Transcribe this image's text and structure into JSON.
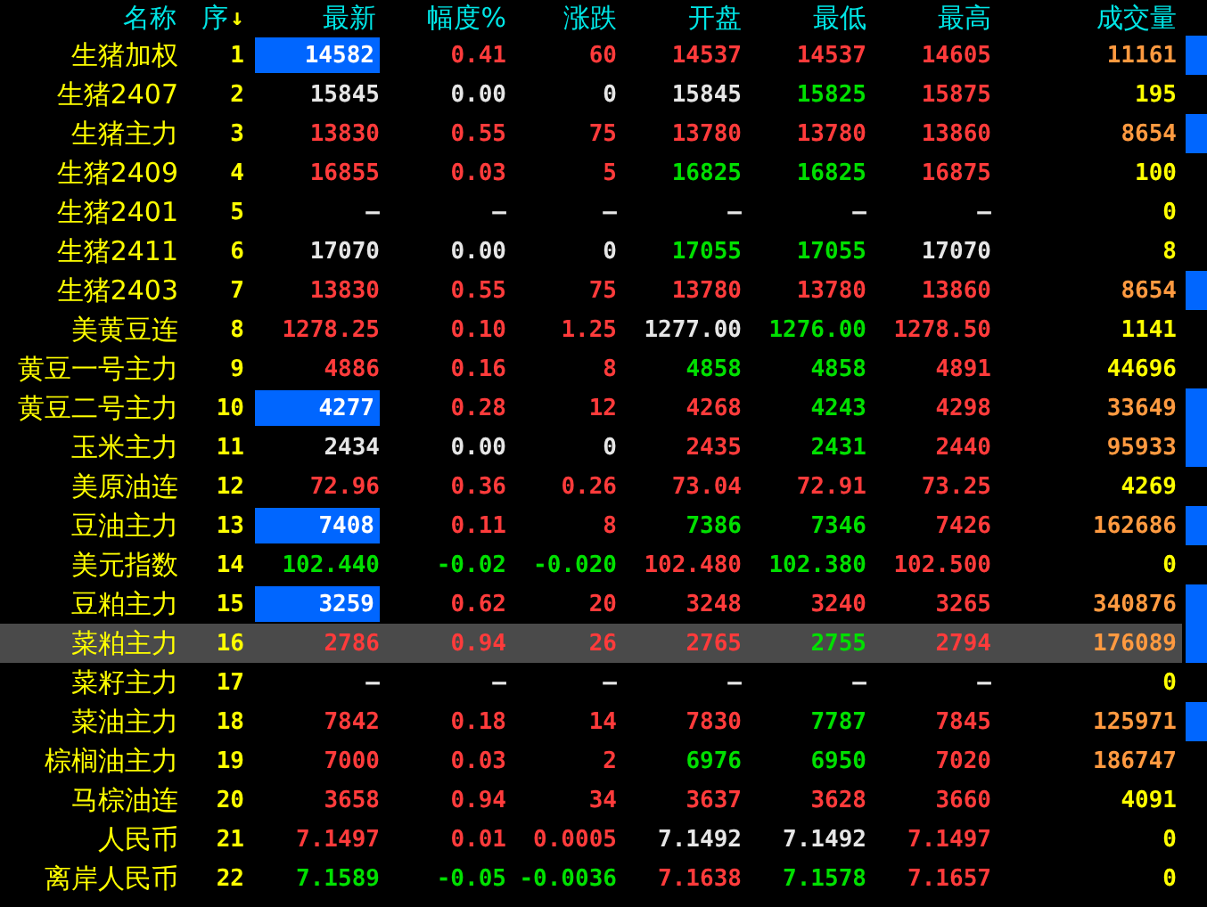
{
  "columns": [
    {
      "label": "名称"
    },
    {
      "label": "序",
      "sort_mark": "↓"
    },
    {
      "label": "最新"
    },
    {
      "label": "幅度%"
    },
    {
      "label": "涨跌"
    },
    {
      "label": "开盘"
    },
    {
      "label": "最低"
    },
    {
      "label": "最高"
    },
    {
      "label": "成交量"
    }
  ],
  "rows": [
    {
      "name": "生猪加权",
      "no": "1",
      "flash": true,
      "marker": true,
      "selected": false,
      "cells": [
        {
          "text": "14582",
          "color": "#ffffff"
        },
        {
          "text": "0.41",
          "color": "#ff3b3b"
        },
        {
          "text": "60",
          "color": "#ff3b3b"
        },
        {
          "text": "14537",
          "color": "#ff3b3b"
        },
        {
          "text": "14537",
          "color": "#ff3b3b"
        },
        {
          "text": "14605",
          "color": "#ff3b3b"
        },
        {
          "text": "11161",
          "color": "#ff9a40"
        }
      ]
    },
    {
      "name": "生猪2407",
      "no": "2",
      "flash": false,
      "marker": false,
      "selected": false,
      "cells": [
        {
          "text": "15845",
          "color": "#e6e6e6"
        },
        {
          "text": "0.00",
          "color": "#e6e6e6"
        },
        {
          "text": "0",
          "color": "#e6e6e6"
        },
        {
          "text": "15845",
          "color": "#e6e6e6"
        },
        {
          "text": "15825",
          "color": "#00e000"
        },
        {
          "text": "15875",
          "color": "#ff3b3b"
        },
        {
          "text": "195",
          "color": "#ffff00"
        }
      ]
    },
    {
      "name": "生猪主力",
      "no": "3",
      "flash": false,
      "marker": true,
      "selected": false,
      "cells": [
        {
          "text": "13830",
          "color": "#ff3b3b"
        },
        {
          "text": "0.55",
          "color": "#ff3b3b"
        },
        {
          "text": "75",
          "color": "#ff3b3b"
        },
        {
          "text": "13780",
          "color": "#ff3b3b"
        },
        {
          "text": "13780",
          "color": "#ff3b3b"
        },
        {
          "text": "13860",
          "color": "#ff3b3b"
        },
        {
          "text": "8654",
          "color": "#ff9a40"
        }
      ]
    },
    {
      "name": "生猪2409",
      "no": "4",
      "flash": false,
      "marker": false,
      "selected": false,
      "cells": [
        {
          "text": "16855",
          "color": "#ff3b3b"
        },
        {
          "text": "0.03",
          "color": "#ff3b3b"
        },
        {
          "text": "5",
          "color": "#ff3b3b"
        },
        {
          "text": "16825",
          "color": "#00e000"
        },
        {
          "text": "16825",
          "color": "#00e000"
        },
        {
          "text": "16875",
          "color": "#ff3b3b"
        },
        {
          "text": "100",
          "color": "#ffff00"
        }
      ]
    },
    {
      "name": "生猪2401",
      "no": "5",
      "flash": false,
      "marker": false,
      "selected": false,
      "cells": [
        {
          "text": "—",
          "color": "#e6e6e6"
        },
        {
          "text": "—",
          "color": "#e6e6e6"
        },
        {
          "text": "—",
          "color": "#e6e6e6"
        },
        {
          "text": "—",
          "color": "#e6e6e6"
        },
        {
          "text": "—",
          "color": "#e6e6e6"
        },
        {
          "text": "—",
          "color": "#e6e6e6"
        },
        {
          "text": "0",
          "color": "#ffff00"
        }
      ]
    },
    {
      "name": "生猪2411",
      "no": "6",
      "flash": false,
      "marker": false,
      "selected": false,
      "cells": [
        {
          "text": "17070",
          "color": "#e6e6e6"
        },
        {
          "text": "0.00",
          "color": "#e6e6e6"
        },
        {
          "text": "0",
          "color": "#e6e6e6"
        },
        {
          "text": "17055",
          "color": "#00e000"
        },
        {
          "text": "17055",
          "color": "#00e000"
        },
        {
          "text": "17070",
          "color": "#e6e6e6"
        },
        {
          "text": "8",
          "color": "#ffff00"
        }
      ]
    },
    {
      "name": "生猪2403",
      "no": "7",
      "flash": false,
      "marker": true,
      "selected": false,
      "cells": [
        {
          "text": "13830",
          "color": "#ff3b3b"
        },
        {
          "text": "0.55",
          "color": "#ff3b3b"
        },
        {
          "text": "75",
          "color": "#ff3b3b"
        },
        {
          "text": "13780",
          "color": "#ff3b3b"
        },
        {
          "text": "13780",
          "color": "#ff3b3b"
        },
        {
          "text": "13860",
          "color": "#ff3b3b"
        },
        {
          "text": "8654",
          "color": "#ff9a40"
        }
      ]
    },
    {
      "name": "美黄豆连",
      "no": "8",
      "flash": false,
      "marker": false,
      "selected": false,
      "cells": [
        {
          "text": "1278.25",
          "color": "#ff3b3b"
        },
        {
          "text": "0.10",
          "color": "#ff3b3b"
        },
        {
          "text": "1.25",
          "color": "#ff3b3b"
        },
        {
          "text": "1277.00",
          "color": "#e6e6e6"
        },
        {
          "text": "1276.00",
          "color": "#00e000"
        },
        {
          "text": "1278.50",
          "color": "#ff3b3b"
        },
        {
          "text": "1141",
          "color": "#ffff00"
        }
      ]
    },
    {
      "name": "黄豆一号主力",
      "no": "9",
      "flash": false,
      "marker": false,
      "selected": false,
      "cells": [
        {
          "text": "4886",
          "color": "#ff3b3b"
        },
        {
          "text": "0.16",
          "color": "#ff3b3b"
        },
        {
          "text": "8",
          "color": "#ff3b3b"
        },
        {
          "text": "4858",
          "color": "#00e000"
        },
        {
          "text": "4858",
          "color": "#00e000"
        },
        {
          "text": "4891",
          "color": "#ff3b3b"
        },
        {
          "text": "44696",
          "color": "#ffff00"
        }
      ]
    },
    {
      "name": "黄豆二号主力",
      "no": "10",
      "flash": true,
      "marker": true,
      "selected": false,
      "cells": [
        {
          "text": "4277",
          "color": "#ffffff"
        },
        {
          "text": "0.28",
          "color": "#ff3b3b"
        },
        {
          "text": "12",
          "color": "#ff3b3b"
        },
        {
          "text": "4268",
          "color": "#ff3b3b"
        },
        {
          "text": "4243",
          "color": "#00e000"
        },
        {
          "text": "4298",
          "color": "#ff3b3b"
        },
        {
          "text": "33649",
          "color": "#ff9a40"
        }
      ]
    },
    {
      "name": "玉米主力",
      "no": "11",
      "flash": false,
      "marker": true,
      "selected": false,
      "cells": [
        {
          "text": "2434",
          "color": "#e6e6e6"
        },
        {
          "text": "0.00",
          "color": "#e6e6e6"
        },
        {
          "text": "0",
          "color": "#e6e6e6"
        },
        {
          "text": "2435",
          "color": "#ff3b3b"
        },
        {
          "text": "2431",
          "color": "#00e000"
        },
        {
          "text": "2440",
          "color": "#ff3b3b"
        },
        {
          "text": "95933",
          "color": "#ff9a40"
        }
      ]
    },
    {
      "name": "美原油连",
      "no": "12",
      "flash": false,
      "marker": false,
      "selected": false,
      "cells": [
        {
          "text": "72.96",
          "color": "#ff3b3b"
        },
        {
          "text": "0.36",
          "color": "#ff3b3b"
        },
        {
          "text": "0.26",
          "color": "#ff3b3b"
        },
        {
          "text": "73.04",
          "color": "#ff3b3b"
        },
        {
          "text": "72.91",
          "color": "#ff3b3b"
        },
        {
          "text": "73.25",
          "color": "#ff3b3b"
        },
        {
          "text": "4269",
          "color": "#ffff00"
        }
      ]
    },
    {
      "name": "豆油主力",
      "no": "13",
      "flash": true,
      "marker": true,
      "selected": false,
      "cells": [
        {
          "text": "7408",
          "color": "#ffffff"
        },
        {
          "text": "0.11",
          "color": "#ff3b3b"
        },
        {
          "text": "8",
          "color": "#ff3b3b"
        },
        {
          "text": "7386",
          "color": "#00e000"
        },
        {
          "text": "7346",
          "color": "#00e000"
        },
        {
          "text": "7426",
          "color": "#ff3b3b"
        },
        {
          "text": "162686",
          "color": "#ff9a40"
        }
      ]
    },
    {
      "name": "美元指数",
      "no": "14",
      "flash": false,
      "marker": false,
      "selected": false,
      "cells": [
        {
          "text": "102.440",
          "color": "#00e000"
        },
        {
          "text": "-0.02",
          "color": "#00e000"
        },
        {
          "text": "-0.020",
          "color": "#00e000"
        },
        {
          "text": "102.480",
          "color": "#ff3b3b"
        },
        {
          "text": "102.380",
          "color": "#00e000"
        },
        {
          "text": "102.500",
          "color": "#ff3b3b"
        },
        {
          "text": "0",
          "color": "#ffff00"
        }
      ]
    },
    {
      "name": "豆粕主力",
      "no": "15",
      "flash": true,
      "marker": true,
      "selected": false,
      "cells": [
        {
          "text": "3259",
          "color": "#ffffff"
        },
        {
          "text": "0.62",
          "color": "#ff3b3b"
        },
        {
          "text": "20",
          "color": "#ff3b3b"
        },
        {
          "text": "3248",
          "color": "#ff3b3b"
        },
        {
          "text": "3240",
          "color": "#ff3b3b"
        },
        {
          "text": "3265",
          "color": "#ff3b3b"
        },
        {
          "text": "340876",
          "color": "#ff9a40"
        }
      ]
    },
    {
      "name": "菜粕主力",
      "no": "16",
      "flash": false,
      "marker": true,
      "selected": true,
      "cells": [
        {
          "text": "2786",
          "color": "#ff3b3b"
        },
        {
          "text": "0.94",
          "color": "#ff3b3b"
        },
        {
          "text": "26",
          "color": "#ff3b3b"
        },
        {
          "text": "2765",
          "color": "#ff3b3b"
        },
        {
          "text": "2755",
          "color": "#00e000"
        },
        {
          "text": "2794",
          "color": "#ff3b3b"
        },
        {
          "text": "176089",
          "color": "#ff9a40"
        }
      ]
    },
    {
      "name": "菜籽主力",
      "no": "17",
      "flash": false,
      "marker": false,
      "selected": false,
      "cells": [
        {
          "text": "—",
          "color": "#e6e6e6"
        },
        {
          "text": "—",
          "color": "#e6e6e6"
        },
        {
          "text": "—",
          "color": "#e6e6e6"
        },
        {
          "text": "—",
          "color": "#e6e6e6"
        },
        {
          "text": "—",
          "color": "#e6e6e6"
        },
        {
          "text": "—",
          "color": "#e6e6e6"
        },
        {
          "text": "0",
          "color": "#ffff00"
        }
      ]
    },
    {
      "name": "菜油主力",
      "no": "18",
      "flash": false,
      "marker": true,
      "selected": false,
      "cells": [
        {
          "text": "7842",
          "color": "#ff3b3b"
        },
        {
          "text": "0.18",
          "color": "#ff3b3b"
        },
        {
          "text": "14",
          "color": "#ff3b3b"
        },
        {
          "text": "7830",
          "color": "#ff3b3b"
        },
        {
          "text": "7787",
          "color": "#00e000"
        },
        {
          "text": "7845",
          "color": "#ff3b3b"
        },
        {
          "text": "125971",
          "color": "#ff9a40"
        }
      ]
    },
    {
      "name": "棕榈油主力",
      "no": "19",
      "flash": false,
      "marker": false,
      "selected": false,
      "cells": [
        {
          "text": "7000",
          "color": "#ff3b3b"
        },
        {
          "text": "0.03",
          "color": "#ff3b3b"
        },
        {
          "text": "2",
          "color": "#ff3b3b"
        },
        {
          "text": "6976",
          "color": "#00e000"
        },
        {
          "text": "6950",
          "color": "#00e000"
        },
        {
          "text": "7020",
          "color": "#ff3b3b"
        },
        {
          "text": "186747",
          "color": "#ff9a40"
        }
      ]
    },
    {
      "name": "马棕油连",
      "no": "20",
      "flash": false,
      "marker": false,
      "selected": false,
      "cells": [
        {
          "text": "3658",
          "color": "#ff3b3b"
        },
        {
          "text": "0.94",
          "color": "#ff3b3b"
        },
        {
          "text": "34",
          "color": "#ff3b3b"
        },
        {
          "text": "3637",
          "color": "#ff3b3b"
        },
        {
          "text": "3628",
          "color": "#ff3b3b"
        },
        {
          "text": "3660",
          "color": "#ff3b3b"
        },
        {
          "text": "4091",
          "color": "#ffff00"
        }
      ]
    },
    {
      "name": "人民币",
      "no": "21",
      "flash": false,
      "marker": false,
      "selected": false,
      "cells": [
        {
          "text": "7.1497",
          "color": "#ff3b3b"
        },
        {
          "text": "0.01",
          "color": "#ff3b3b"
        },
        {
          "text": "0.0005",
          "color": "#ff3b3b"
        },
        {
          "text": "7.1492",
          "color": "#e6e6e6"
        },
        {
          "text": "7.1492",
          "color": "#e6e6e6"
        },
        {
          "text": "7.1497",
          "color": "#ff3b3b"
        },
        {
          "text": "0",
          "color": "#ffff00"
        }
      ]
    },
    {
      "name": "离岸人民币",
      "no": "22",
      "flash": false,
      "marker": false,
      "selected": false,
      "cells": [
        {
          "text": "7.1589",
          "color": "#00e000"
        },
        {
          "text": "-0.05",
          "color": "#00e000"
        },
        {
          "text": "-0.0036",
          "color": "#00e000"
        },
        {
          "text": "7.1638",
          "color": "#ff3b3b"
        },
        {
          "text": "7.1578",
          "color": "#00e000"
        },
        {
          "text": "7.1657",
          "color": "#ff3b3b"
        },
        {
          "text": "0",
          "color": "#ffff00"
        }
      ]
    }
  ]
}
